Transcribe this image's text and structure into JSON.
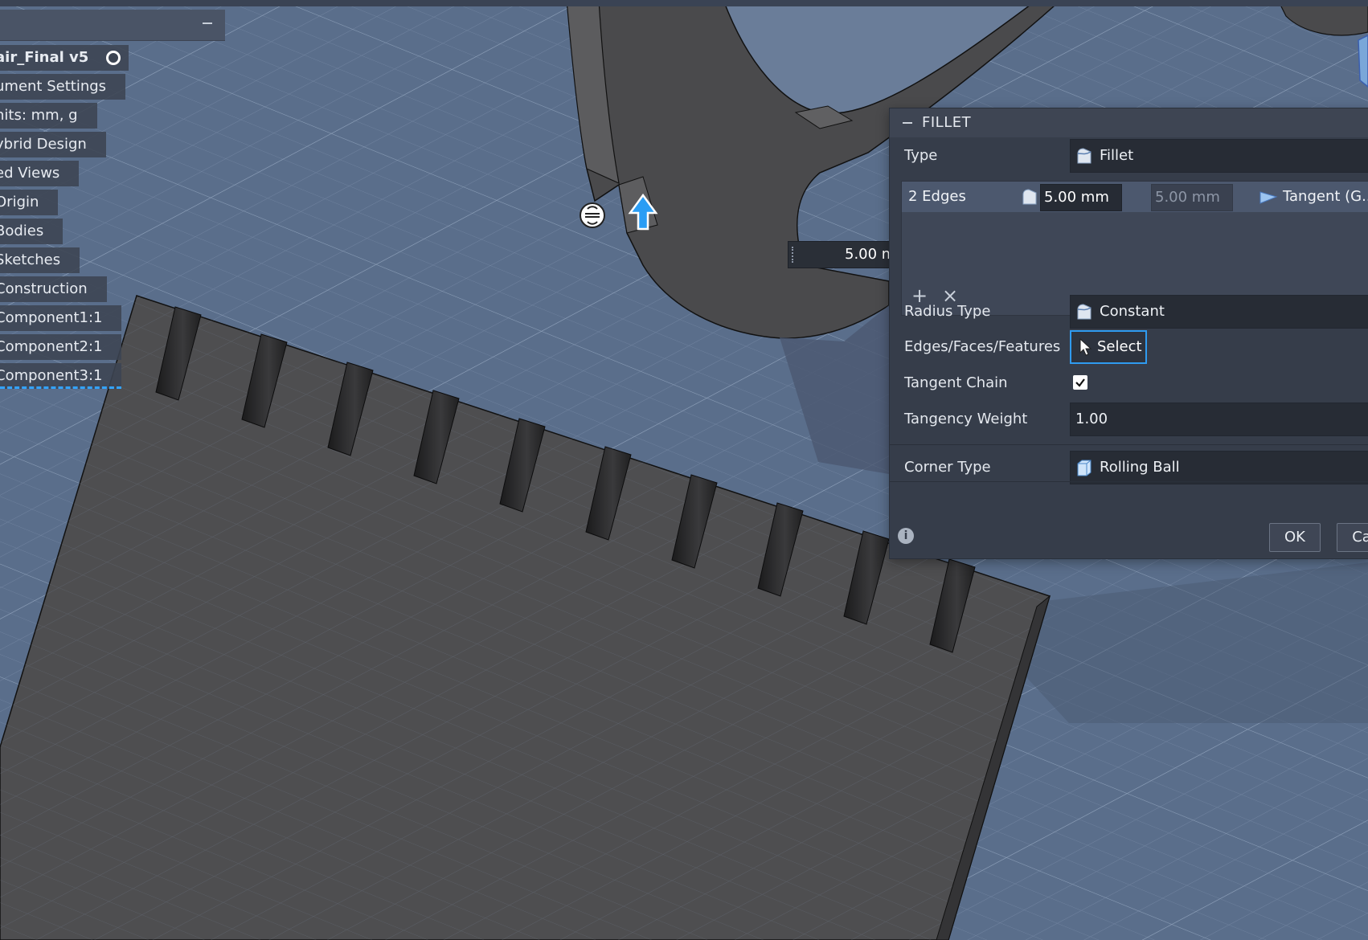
{
  "browser": {
    "root": "air_Final v5",
    "items": [
      {
        "label": "ument Settings"
      },
      {
        "label": "nits: mm, g"
      },
      {
        "label": "ybrid Design"
      },
      {
        "label": "ed Views"
      },
      {
        "label": "Origin"
      },
      {
        "label": "Bodies"
      },
      {
        "label": "Sketches"
      },
      {
        "label": "Construction"
      },
      {
        "label": "Component1:1"
      },
      {
        "label": "Component2:1"
      },
      {
        "label": "Component3:1"
      }
    ]
  },
  "viewport": {
    "dimension_value": "5.00 m",
    "colors": {
      "grid_bg": "#5b6f8c",
      "body": "#4c4c4e",
      "accent": "#2f9bf0"
    }
  },
  "fillet": {
    "title": "FILLET",
    "type_label": "Type",
    "type_value": "Fillet",
    "edge_row": {
      "name": "2 Edges",
      "radius": "5.00 mm",
      "radius2": "5.00 mm",
      "continuity": "Tangent (G..."
    },
    "add_icon": "+",
    "remove_icon": "×",
    "radius_type_label": "Radius Type",
    "radius_type_value": "Constant",
    "edges_label": "Edges/Faces/Features",
    "select_label": "Select",
    "tangent_chain_label": "Tangent Chain",
    "tangent_chain_checked": true,
    "tangency_weight_label": "Tangency Weight",
    "tangency_weight_value": "1.00",
    "corner_type_label": "Corner Type",
    "corner_type_value": "Rolling Ball",
    "ok_label": "OK",
    "cancel_label": "Ca"
  }
}
